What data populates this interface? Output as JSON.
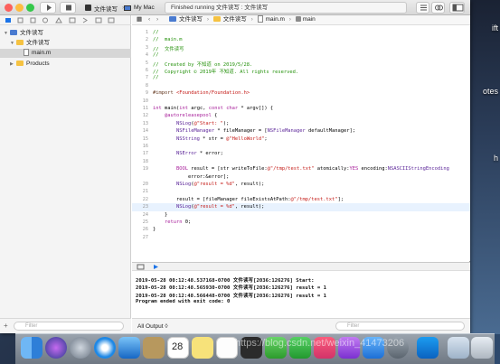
{
  "desktop": {
    "side_labels": [
      "ift",
      "otes",
      "h"
    ]
  },
  "toolbar": {
    "scheme_target": "文件读写",
    "scheme_device": "My Mac",
    "status": "Finished running 文件读写 : 文件读写"
  },
  "navigator": {
    "project": "文件读写",
    "group": "文件读写",
    "file": "main.m",
    "products": "Products",
    "filter_placeholder": "Filter"
  },
  "jumpbar": {
    "crumbs": [
      "文件读写",
      "文件读写",
      "main.m",
      "main"
    ]
  },
  "editor": {
    "line_numbers": [
      "1",
      "2",
      "3",
      "4",
      "5",
      "6",
      "7",
      "8",
      "9",
      "10",
      "11",
      "12",
      "13",
      "14",
      "15",
      "16",
      "17",
      "18",
      "19",
      "",
      "20",
      "21",
      "22",
      "23",
      "24",
      "25",
      "26",
      "27"
    ],
    "lines": [
      "//",
      "//  main.m",
      "//  文件读写",
      "//",
      "//  Created by 不知道 on 2019/5/28.",
      "//  Copyright © 2019年 不知道. All rights reserved.",
      "//",
      "",
      "#import <Foundation/Foundation.h>",
      "",
      "int main(int argc, const char * argv[]) {",
      "    @autoreleasepool {",
      "        NSLog(@\"Start: \");",
      "        NSFileManager * fileManager = [NSFileManager defaultManager];",
      "        NSString * str = @\"HelloWorld\";",
      "",
      "        NSError * error;",
      "",
      "        BOOL result = [str writeToFile:@\"/tmp/test.txt\" atomically:YES encoding:NSASCIIStringEncoding",
      "            error:&error];",
      "        NSLog(@\"result = %d\", result);",
      "",
      "        result = [fileManager fileExistsAtPath:@\"/tmp/test.txt\"];",
      "        NSLog(@\"result = %d\", result);",
      "    }",
      "    return 0;",
      "}",
      ""
    ]
  },
  "console": {
    "lines": [
      "2019-05-28 00:12:48.537168-0700 文件读写[2036:126276] Start:",
      "2019-05-28 00:12:48.565930-0700 文件读写[2036:126276] result = 1",
      "2019-05-28 00:12:48.566448-0700 文件读写[2036:126276] result = 1",
      "Program ended with exit code: 0"
    ],
    "output_selector": "All Output ◊",
    "filter_placeholder": "Filter"
  },
  "watermark": "https://blog.csdn.net/weixin_41473206",
  "colors": {
    "comment": "#26920d",
    "keyword": "#a8219b",
    "string": "#c41a16",
    "class": "#5c2699",
    "accent": "#1a73e8"
  }
}
